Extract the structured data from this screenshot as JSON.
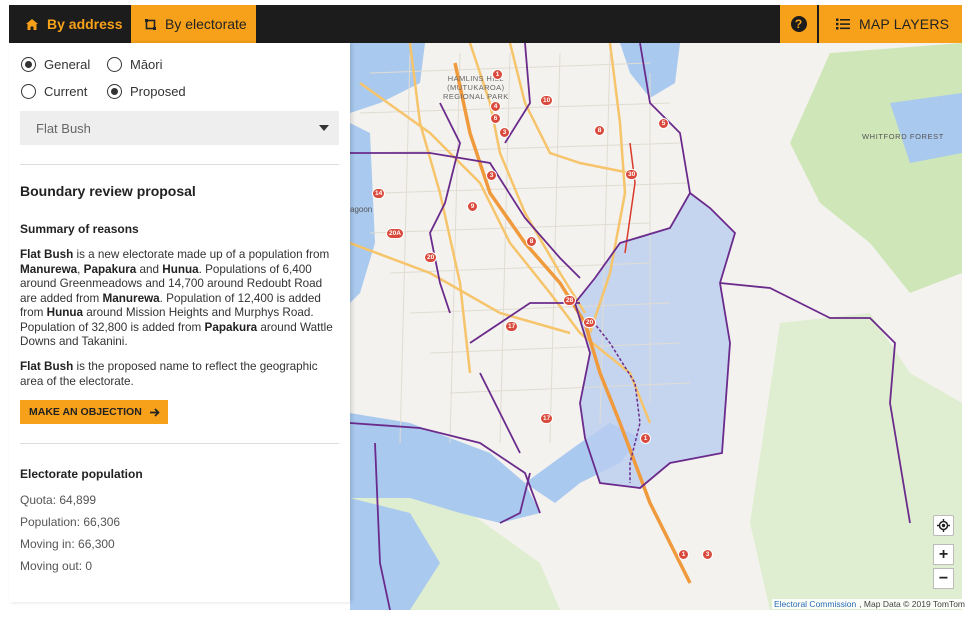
{
  "nav": {
    "tab_address": "By address",
    "tab_electorate": "By electorate",
    "map_layers": "MAP LAYERS",
    "help": "?"
  },
  "filters": {
    "general": "General",
    "maori": "Māori",
    "current": "Current",
    "proposed": "Proposed",
    "general_selected": true,
    "proposed_selected": true
  },
  "electorate_select": {
    "value": "Flat Bush"
  },
  "proposal": {
    "heading": "Boundary review proposal",
    "summary_heading": "Summary of reasons",
    "p1": [
      {
        "t": "Flat Bush",
        "b": true
      },
      {
        "t": " is a new electorate made up of a population from ",
        "b": false
      },
      {
        "t": "Manurewa",
        "b": true
      },
      {
        "t": ", ",
        "b": false
      },
      {
        "t": "Papakura",
        "b": true
      },
      {
        "t": " and ",
        "b": false
      },
      {
        "t": "Hunua",
        "b": true
      },
      {
        "t": ". Populations of 6,400 around Greenmeadows and 14,700 around Redoubt Road are added from ",
        "b": false
      },
      {
        "t": "Manurewa",
        "b": true
      },
      {
        "t": ". Population of 12,400 is added from ",
        "b": false
      },
      {
        "t": "Hunua",
        "b": true
      },
      {
        "t": " around Mission Heights and Murphys Road. Population of 32,800 is added from ",
        "b": false
      },
      {
        "t": "Papakura",
        "b": true
      },
      {
        "t": " around Wattle Downs and Takanini.",
        "b": false
      }
    ],
    "p2": [
      {
        "t": "Flat Bush",
        "b": true
      },
      {
        "t": " is the proposed name to reflect the geographic area of the electorate.",
        "b": false
      }
    ],
    "objection_button": "MAKE AN OBJECTION"
  },
  "population": {
    "heading": "Electorate population",
    "quota": "Quota: 64,899",
    "population": "Population: 66,306",
    "moving_in": "Moving in: 66,300",
    "moving_out": "Moving out: 0"
  },
  "map": {
    "labels": {
      "hamlins1": "HAMLINS HILL",
      "hamlins2": "(MUTUKAROA)",
      "hamlins3": "REGIONAL PARK",
      "whitford": "WHITFORD FOREST",
      "lagoon": "agoon"
    },
    "route_badges": [
      {
        "n": "1",
        "kind": "state"
      },
      {
        "n": "4",
        "kind": "state"
      },
      {
        "n": "6",
        "kind": "state"
      },
      {
        "n": "10",
        "kind": "state"
      },
      {
        "n": "5",
        "kind": "state"
      },
      {
        "n": "8",
        "kind": "state"
      },
      {
        "n": "3",
        "kind": "state"
      },
      {
        "n": "14",
        "kind": "state"
      },
      {
        "n": "9",
        "kind": "state"
      },
      {
        "n": "20A",
        "kind": "state"
      },
      {
        "n": "20",
        "kind": "state"
      },
      {
        "n": "17",
        "kind": "state"
      },
      {
        "n": "30",
        "kind": "state"
      },
      {
        "n": "8",
        "kind": "state"
      },
      {
        "n": "3",
        "kind": "state"
      },
      {
        "n": "28",
        "kind": "state"
      },
      {
        "n": "20",
        "kind": "state"
      },
      {
        "n": "17",
        "kind": "state"
      },
      {
        "n": "1",
        "kind": "state"
      },
      {
        "n": "1",
        "kind": "state"
      },
      {
        "n": "3",
        "kind": "state"
      }
    ],
    "attribution_link": "Electoral Commission",
    "attribution_text": ", Map Data © 2019 TomTom",
    "zoom_in": "+",
    "zoom_out": "−"
  },
  "colors": {
    "accent": "#f7a11a",
    "topbar": "#1c1c1c",
    "boundary": "#6b2b8c",
    "highlight": "#b9cdf0",
    "water": "#a9c9ef",
    "park": "#cfe7b8"
  }
}
